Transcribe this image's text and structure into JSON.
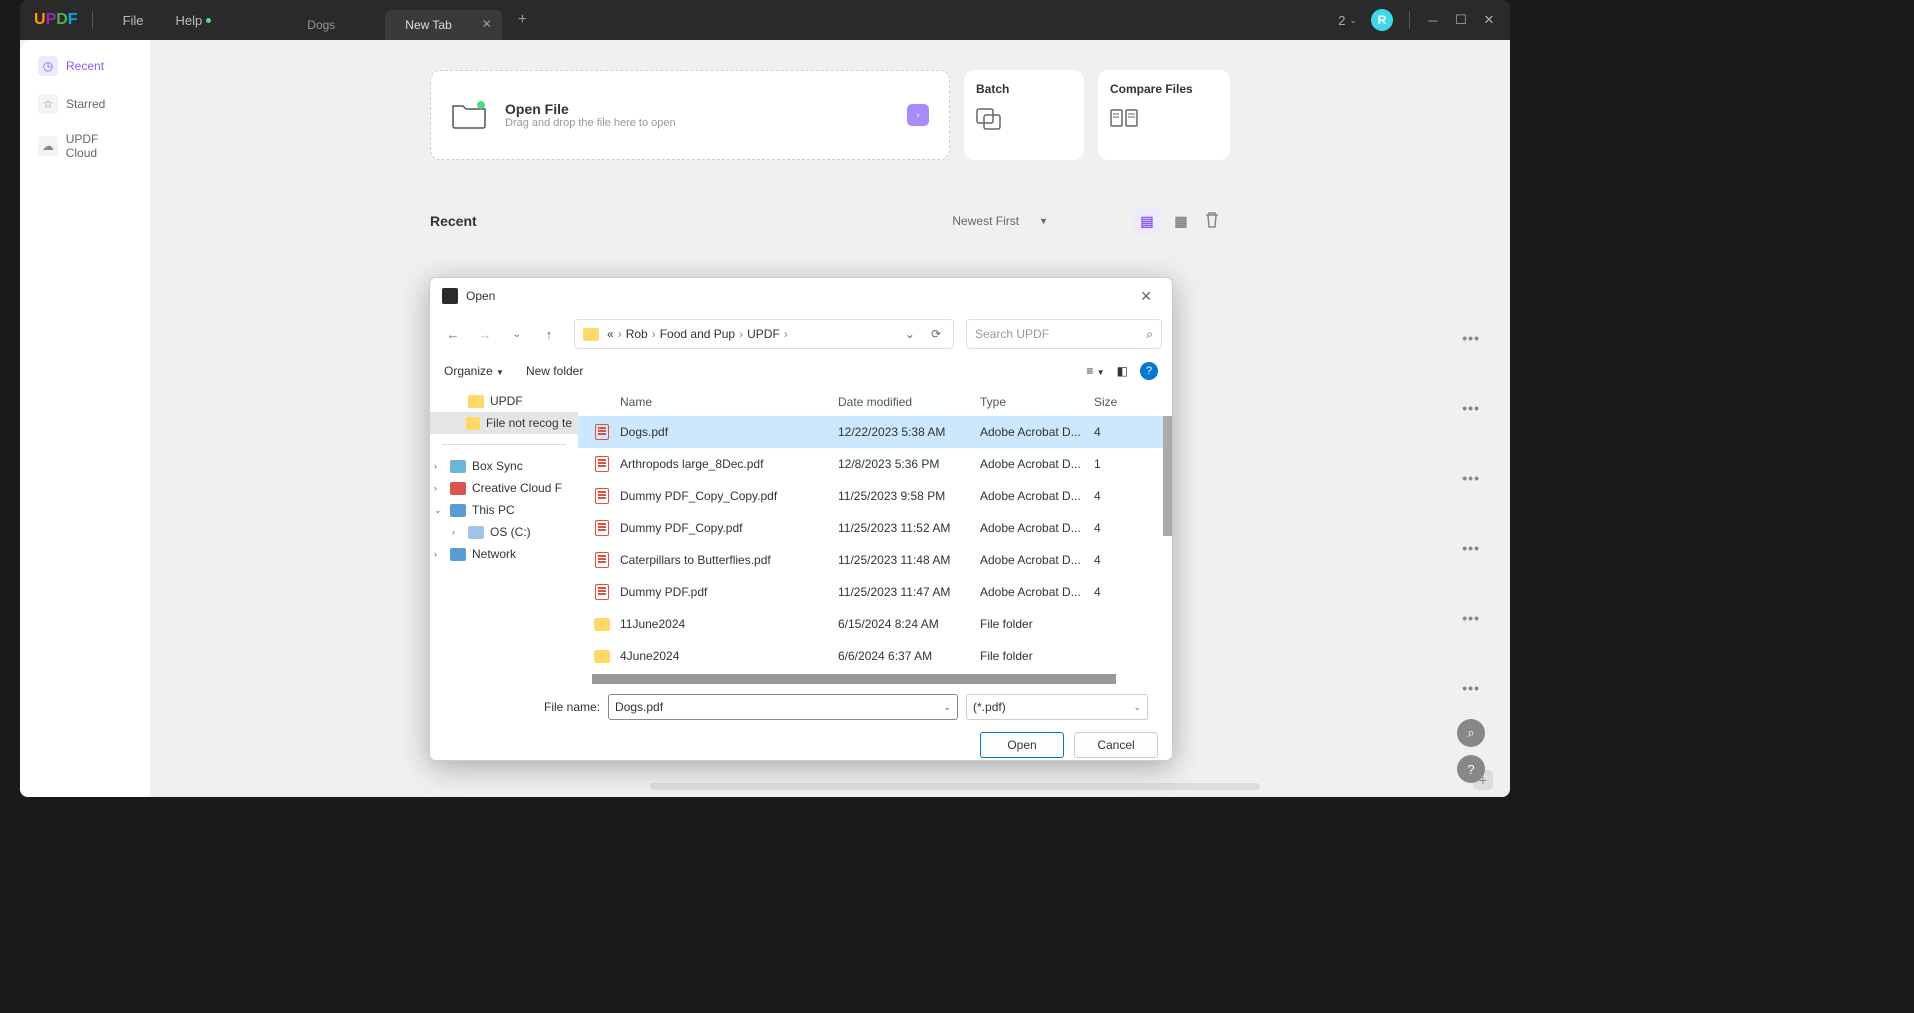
{
  "titlebar": {
    "logo": [
      "U",
      "P",
      "D",
      "F"
    ],
    "menu_file": "File",
    "menu_help": "Help",
    "notif_count": "2",
    "avatar_letter": "R"
  },
  "tabs": [
    {
      "label": "Dogs",
      "active": false
    },
    {
      "label": "New Tab",
      "active": true
    }
  ],
  "sidebar": [
    {
      "label": "Recent",
      "active": true,
      "icon": "◷"
    },
    {
      "label": "Starred",
      "active": false,
      "icon": "☆"
    },
    {
      "label": "UPDF Cloud",
      "active": false,
      "icon": "☁"
    }
  ],
  "open_card": {
    "title": "Open File",
    "subtitle": "Drag and drop the file here to open"
  },
  "batch_card": {
    "title": "Batch"
  },
  "compare_card": {
    "title": "Compare Files"
  },
  "recent": {
    "heading": "Recent",
    "sort": "Newest First"
  },
  "dialog": {
    "title": "Open",
    "breadcrumb": [
      "«",
      "Rob",
      "Food and Pup",
      "UPDF"
    ],
    "search_placeholder": "Search UPDF",
    "organize": "Organize",
    "new_folder": "New folder",
    "tree": [
      {
        "label": "UPDF",
        "type": "folder",
        "indent": 1,
        "sel": false
      },
      {
        "label": "File not recog te",
        "type": "folder",
        "indent": 1,
        "sel": true
      },
      {
        "hr": true
      },
      {
        "label": "Box Sync",
        "type": "box",
        "indent": 0,
        "chev": ">"
      },
      {
        "label": "Creative Cloud F",
        "type": "cc",
        "indent": 0,
        "chev": ">"
      },
      {
        "label": "This PC",
        "type": "pc",
        "indent": 0,
        "chev": "v"
      },
      {
        "label": "OS (C:)",
        "type": "drive",
        "indent": 1,
        "chev": ">"
      },
      {
        "label": "Network",
        "type": "net",
        "indent": 0,
        "chev": ">"
      }
    ],
    "columns": {
      "name": "Name",
      "date": "Date modified",
      "type": "Type",
      "size": "Size"
    },
    "files": [
      {
        "name": "Dogs.pdf",
        "date": "12/22/2023 5:38 AM",
        "type": "Adobe Acrobat D...",
        "size": "4",
        "kind": "pdf",
        "sel": true
      },
      {
        "name": "Arthropods large_8Dec.pdf",
        "date": "12/8/2023 5:36 PM",
        "type": "Adobe Acrobat D...",
        "size": "1",
        "kind": "pdf"
      },
      {
        "name": "Dummy PDF_Copy_Copy.pdf",
        "date": "11/25/2023 9:58 PM",
        "type": "Adobe Acrobat D...",
        "size": "4",
        "kind": "pdf"
      },
      {
        "name": "Dummy PDF_Copy.pdf",
        "date": "11/25/2023 11:52 AM",
        "type": "Adobe Acrobat D...",
        "size": "4",
        "kind": "pdf"
      },
      {
        "name": "Caterpillars to Butterflies.pdf",
        "date": "11/25/2023 11:48 AM",
        "type": "Adobe Acrobat D...",
        "size": "4",
        "kind": "pdf"
      },
      {
        "name": "Dummy PDF.pdf",
        "date": "11/25/2023 11:47 AM",
        "type": "Adobe Acrobat D...",
        "size": "4",
        "kind": "pdf"
      },
      {
        "name": "11June2024",
        "date": "6/15/2024 8:24 AM",
        "type": "File folder",
        "size": "",
        "kind": "folder"
      },
      {
        "name": "4June2024",
        "date": "6/6/2024 6:37 AM",
        "type": "File folder",
        "size": "",
        "kind": "folder"
      }
    ],
    "filename_label": "File name:",
    "filename_value": "Dogs.pdf",
    "filetype": "(*.pdf)",
    "open_btn": "Open",
    "cancel_btn": "Cancel"
  }
}
